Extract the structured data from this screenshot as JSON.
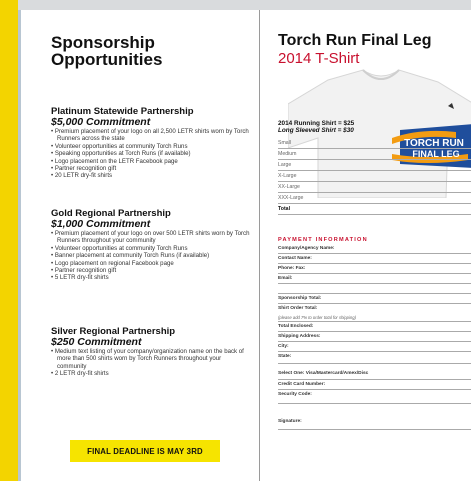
{
  "left": {
    "title": "Sponsorship Opportunities",
    "sections": [
      {
        "name": "Platinum Statewide Partnership",
        "amount": "$5,000 Commitment",
        "items": [
          "Premium placement of your logo on all 2,500 LETR shirts worn by Torch Runners across the state",
          "Volunteer opportunities at community Torch Runs",
          "Speaking opportunities at Torch Runs (if available)",
          "Logo placement on the LETR Facebook page",
          "Partner recognition gift",
          "20 LETR dry-fit shirts"
        ]
      },
      {
        "name": "Gold Regional Partnership",
        "amount": "$1,000 Commitment",
        "items": [
          "Premium placement of your logo on over 500 LETR shirts worn by Torch Runners throughout your community",
          "Volunteer opportunities at community Torch Runs",
          "Banner placement at community Torch Runs (if available)",
          "Logo placement on regional Facebook page",
          "Partner recognition gift",
          "5 LETR dry-fit shirts"
        ]
      },
      {
        "name": "Silver Regional Partnership",
        "amount": "$250 Commitment",
        "items": [
          "Medium text listing of your company/organization name on the back of more than 500 shirts worn by Torch Runners throughout your community",
          "2 LETR dry-fit shirts"
        ]
      }
    ],
    "deadline": "FINAL DEADLINE IS MAY 3RD"
  },
  "right": {
    "title": "Torch Run Final Leg",
    "subtitle": "2014 T-Shirt",
    "shirt_logo_line1": "TORCH RUN",
    "shirt_logo_line2": "FINAL LEG",
    "price_line1": "2014 Running Shirt = $25",
    "price_line2": "Long Sleeved Shirt = $30",
    "sizes": [
      "Small",
      "Medium",
      "Large",
      "X-Large",
      "XX-Large",
      "XXX-Large",
      "Total"
    ],
    "payment_header": "PAYMENT INFORMATION",
    "fields": [
      "Company/Agency Name:",
      "Contact Name:",
      "Phone:                      Fax:",
      "Email:",
      "",
      "Sponsorship Total:",
      "Shirt Order Total:",
      "(please add 7% to order total for shipping)",
      "Total Enclosed:",
      "Shipping Address:",
      "City:",
      "State:",
      "Select One: Visa/Mastercard/Amex/Disc",
      "Credit Card Number:",
      "Security Code:",
      "Signature:"
    ]
  },
  "colors": {
    "accent_red": "#c8102e",
    "deadline_yellow": "#f6e400",
    "edge_yellow": "#f3d400",
    "logo_blue": "#1f4e9c",
    "logo_orange": "#f39c12"
  }
}
